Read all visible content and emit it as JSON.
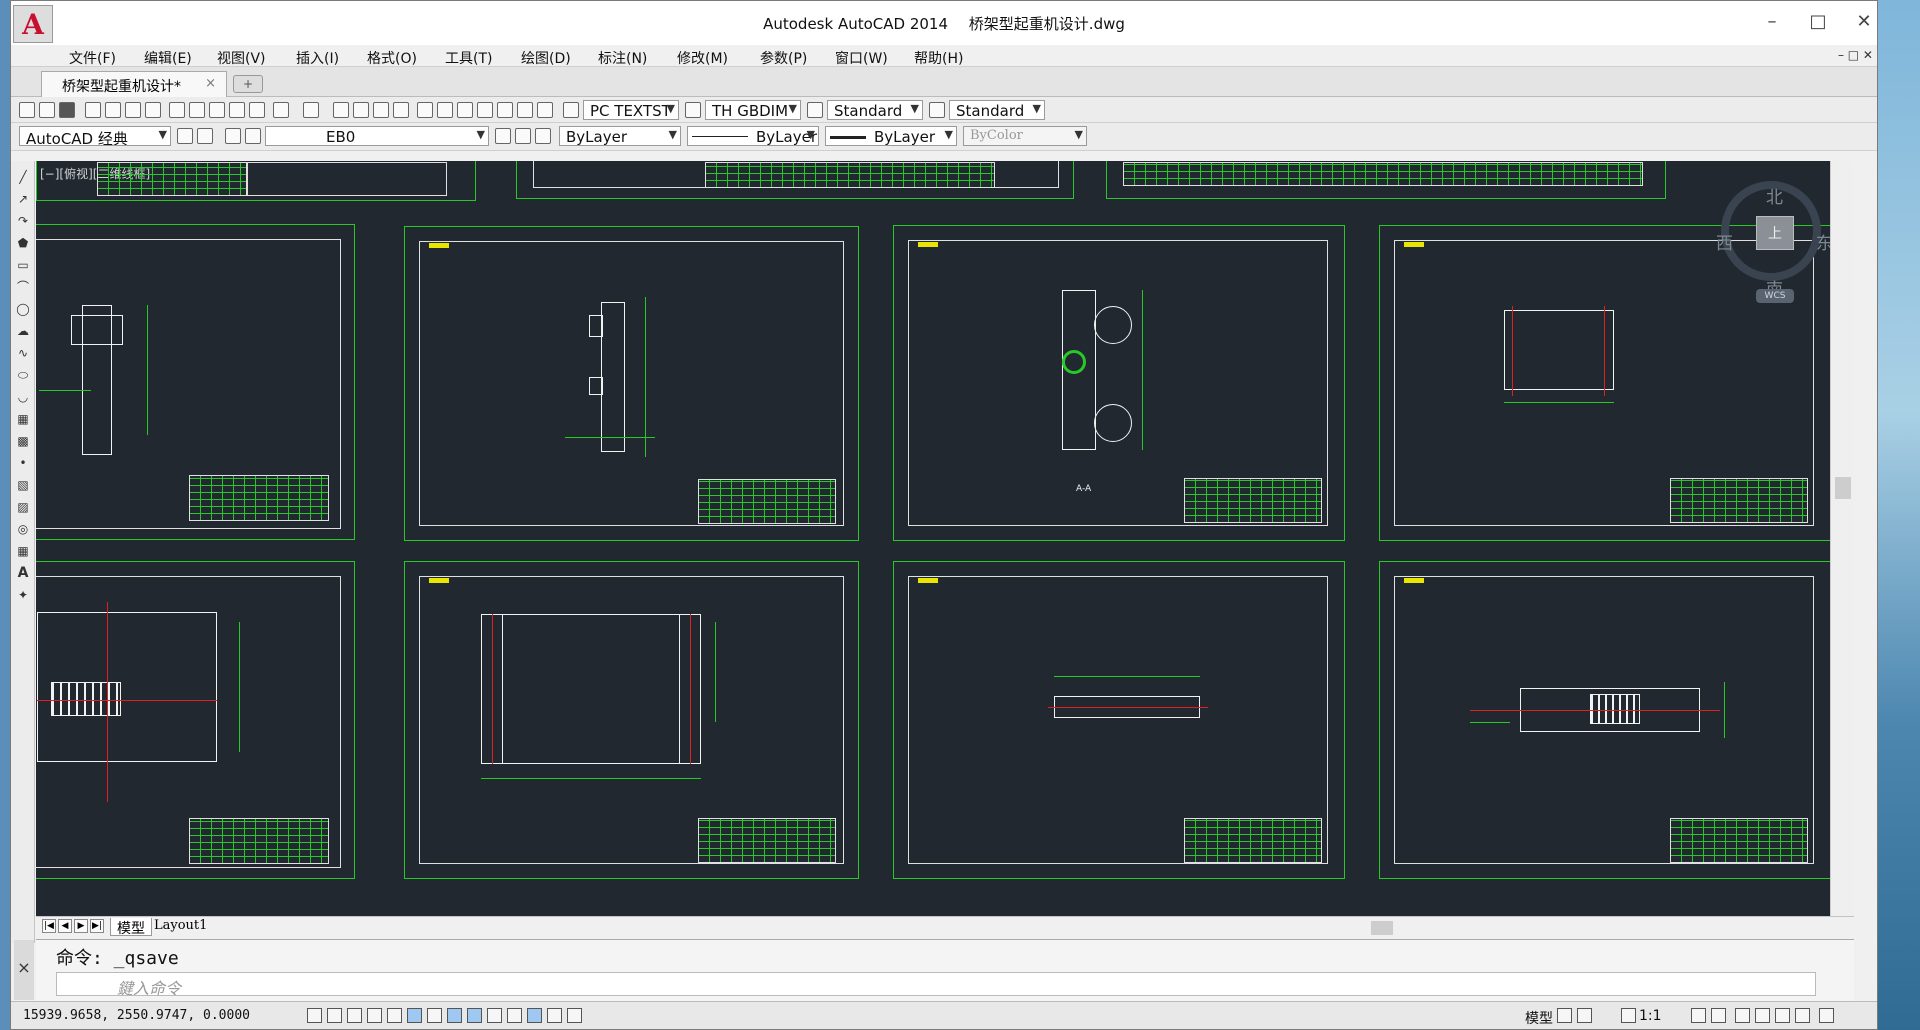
{
  "titlebar": {
    "app_name": "Autodesk AutoCAD 2014",
    "file_name": "桥架型起重机设计.dwg",
    "logo_letter": "A"
  },
  "menu": [
    "文件(F)",
    "编辑(E)",
    "视图(V)",
    "插入(I)",
    "格式(O)",
    "工具(T)",
    "绘图(D)",
    "标注(N)",
    "修改(M)",
    "参数(P)",
    "窗口(W)",
    "帮助(H)"
  ],
  "tabs": {
    "file_tab": "桥架型起重机设计*",
    "close": "×",
    "new_tab": "+"
  },
  "styles": {
    "text_style": "PC TEXTST",
    "dim_style": "TH GBDIM",
    "table_style": "Standard",
    "multileader_style": "Standard"
  },
  "properties": {
    "workspace": "AutoCAD 经典",
    "layer": "EB0",
    "color": "ByLayer",
    "linetype": "ByLayer",
    "lineweight": "ByLayer",
    "plot_style": "ByColor"
  },
  "canvas": {
    "view_label": "[−][俯视][二维线框]",
    "section_label": "A-A"
  },
  "viewcube": {
    "north": "北",
    "south": "南",
    "east": "东",
    "west": "西",
    "top_face": "上",
    "wcs": "WCS"
  },
  "layout_tabs": {
    "model": "模型",
    "layout1": "Layout1"
  },
  "command": {
    "history": "命令:  _qsave",
    "placeholder": "鍵入命令",
    "close": "×"
  },
  "status": {
    "coordinates": "15939.9658,  2550.9747,  0.0000",
    "model_label": "模型",
    "scale": "1:1"
  },
  "colors": {
    "canvas_bg": "#212830",
    "frame": "#28c828",
    "accent_red": "#c8102e"
  }
}
